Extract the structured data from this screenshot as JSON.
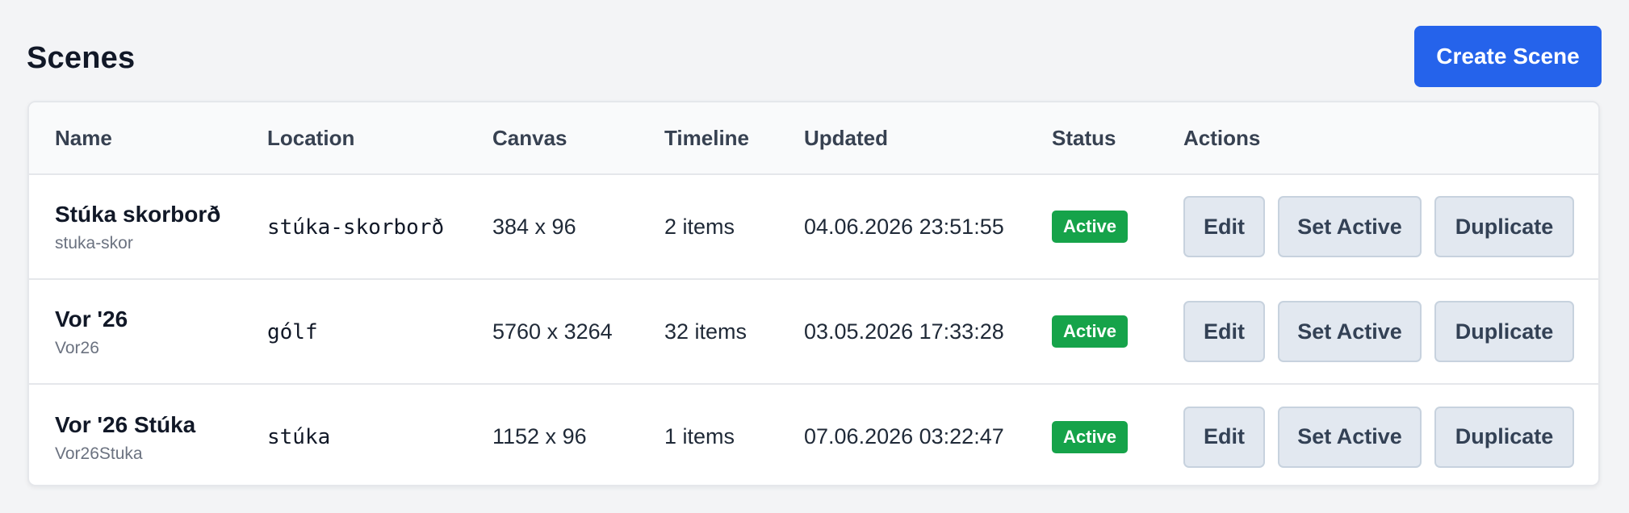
{
  "header": {
    "title": "Scenes",
    "create_label": "Create Scene"
  },
  "table": {
    "columns": {
      "name": "Name",
      "location": "Location",
      "canvas": "Canvas",
      "timeline": "Timeline",
      "updated": "Updated",
      "status": "Status",
      "actions": "Actions"
    },
    "rows": [
      {
        "name": "Stúka skorborð",
        "slug": "stuka-skor",
        "location": "stúka-skorborð",
        "canvas": "384 x 96",
        "timeline": "2 items",
        "updated": "04.06.2026 23:51:55",
        "status": "Active",
        "edit": "Edit",
        "set_active": "Set Active",
        "duplicate": "Duplicate"
      },
      {
        "name": "Vor '26",
        "slug": "Vor26",
        "location": "gólf",
        "canvas": "5760 x 3264",
        "timeline": "32 items",
        "updated": "03.05.2026 17:33:28",
        "status": "Active",
        "edit": "Edit",
        "set_active": "Set Active",
        "duplicate": "Duplicate"
      },
      {
        "name": "Vor '26 Stúka",
        "slug": "Vor26Stuka",
        "location": "stúka",
        "canvas": "1152 x 96",
        "timeline": "1 items",
        "updated": "07.06.2026 03:22:47",
        "status": "Active",
        "edit": "Edit",
        "set_active": "Set Active",
        "duplicate": "Duplicate"
      }
    ]
  },
  "colors": {
    "primary": "#2563eb",
    "status_active": "#16a34a",
    "page_bg": "#f3f4f6",
    "secondary_button": "#e2e8f0"
  }
}
